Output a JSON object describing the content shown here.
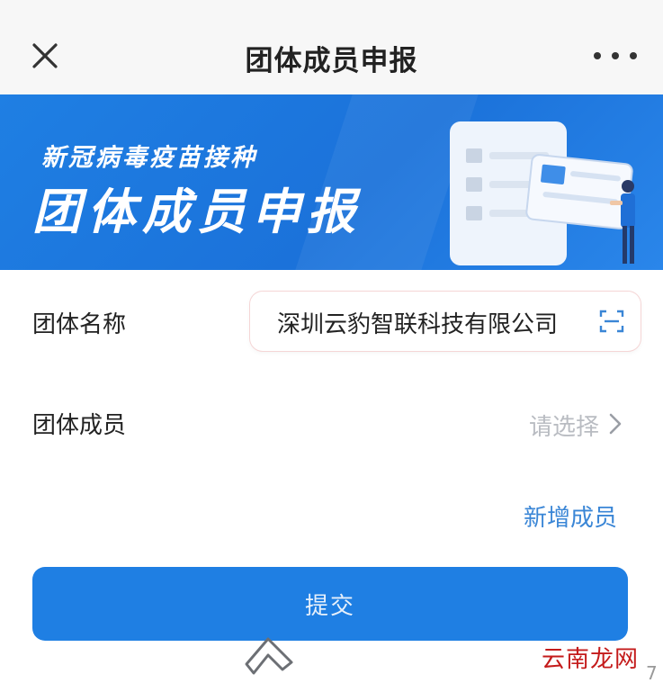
{
  "header": {
    "title": "团体成员申报",
    "close_icon": "close-icon",
    "more_icon": "more-icon"
  },
  "banner": {
    "subtitle": "新冠病毒疫苗接种",
    "title": "团体成员申报"
  },
  "form": {
    "group_name_label": "团体名称",
    "group_name_value": "深圳云豹智联科技有限公司",
    "group_member_label": "团体成员",
    "group_member_placeholder": "请选择",
    "add_member_label": "新增成员",
    "submit_label": "提交"
  },
  "watermark": "云南龙网",
  "page_corner": "7",
  "colors": {
    "accent": "#1f7fe3",
    "link": "#3a86d6",
    "placeholder": "#b9bcc2"
  }
}
